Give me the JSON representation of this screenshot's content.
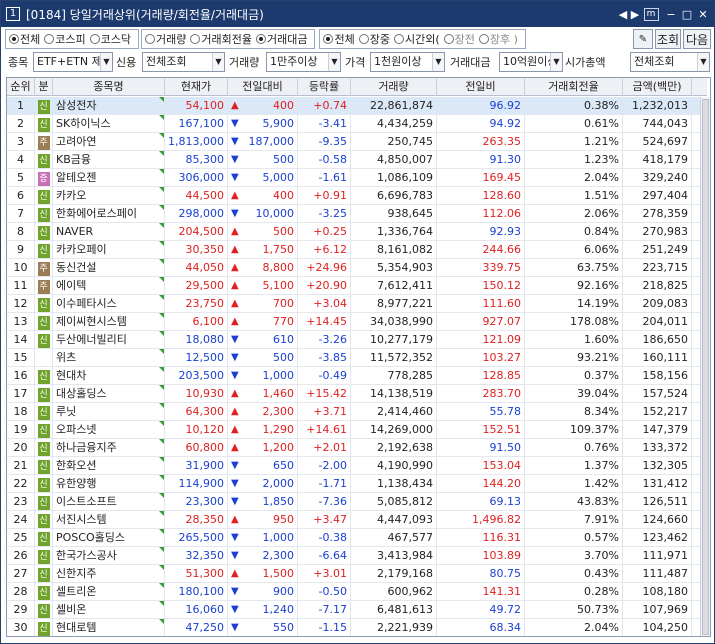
{
  "window": {
    "number": "1",
    "title": "[0184] 당일거래상위(거래량/회전율/거래대금)",
    "ctrl_arrows": "◀ ▶",
    "ctrl_box": "m",
    "ctrl_close": "✕"
  },
  "filters": {
    "market": [
      "전체",
      "코스피",
      "코스닥"
    ],
    "market_selected": 0,
    "sort": [
      "거래량",
      "거래회전율",
      "거래대금"
    ],
    "sort_selected": 2,
    "session": [
      "전체",
      "장중",
      "시간외(",
      "장전",
      "장후 )"
    ],
    "session_selected": 0,
    "query_button": "조회",
    "next_button": "다음"
  },
  "conditions": {
    "stock_label": "종목",
    "stock_value": "ETF+ETN 제",
    "credit_label": "신용",
    "credit_value": "전체조회",
    "volume_label": "거래량",
    "volume_value": "1만주이상",
    "price_label": "가격",
    "price_value": "1천원이상",
    "amount_label": "거래대금",
    "amount_value": "10억원이상",
    "mcap_label": "시가총액",
    "mcap_value": "전체조회"
  },
  "columns": [
    "순위",
    "분",
    "종목명",
    "현재가",
    "전일대비",
    "등락률",
    "거래량",
    "전일비",
    "거래회전율",
    "금액(백만)"
  ],
  "rows": [
    {
      "rank": "1",
      "badge": "신",
      "name": "삼성전자",
      "price": "54,100",
      "dir": "up",
      "change": "400",
      "rate": "+0.74",
      "volume": "22,861,874",
      "prev": "96.92",
      "prev_dir": "dn",
      "turnover": "0.38%",
      "amount": "1,232,013"
    },
    {
      "rank": "2",
      "badge": "신",
      "name": "SK하이닉스",
      "price": "167,100",
      "dir": "dn",
      "change": "5,900",
      "rate": "-3.41",
      "volume": "4,434,259",
      "prev": "94.92",
      "prev_dir": "dn",
      "turnover": "0.61%",
      "amount": "744,043"
    },
    {
      "rank": "3",
      "badge": "주",
      "name": "고려아연",
      "price": "1,813,000",
      "dir": "dn",
      "change": "187,000",
      "rate": "-9.35",
      "volume": "250,745",
      "prev": "263.35",
      "prev_dir": "up",
      "turnover": "1.21%",
      "amount": "524,697"
    },
    {
      "rank": "4",
      "badge": "신",
      "name": "KB금융",
      "price": "85,300",
      "dir": "dn",
      "change": "500",
      "rate": "-0.58",
      "volume": "4,850,007",
      "prev": "91.30",
      "prev_dir": "dn",
      "turnover": "1.23%",
      "amount": "418,179"
    },
    {
      "rank": "5",
      "badge": "증",
      "name": "알테오젠",
      "price": "306,000",
      "dir": "dn",
      "change": "5,000",
      "rate": "-1.61",
      "volume": "1,086,109",
      "prev": "169.45",
      "prev_dir": "up",
      "turnover": "2.04%",
      "amount": "329,240"
    },
    {
      "rank": "6",
      "badge": "신",
      "name": "카카오",
      "price": "44,500",
      "dir": "up",
      "change": "400",
      "rate": "+0.91",
      "volume": "6,696,783",
      "prev": "128.60",
      "prev_dir": "up",
      "turnover": "1.51%",
      "amount": "297,404"
    },
    {
      "rank": "7",
      "badge": "신",
      "name": "한화에어로스페이",
      "price": "298,000",
      "dir": "dn",
      "change": "10,000",
      "rate": "-3.25",
      "volume": "938,645",
      "prev": "112.06",
      "prev_dir": "up",
      "turnover": "2.06%",
      "amount": "278,359"
    },
    {
      "rank": "8",
      "badge": "신",
      "name": "NAVER",
      "price": "204,500",
      "dir": "up",
      "change": "500",
      "rate": "+0.25",
      "volume": "1,336,764",
      "prev": "92.93",
      "prev_dir": "dn",
      "turnover": "0.84%",
      "amount": "270,983"
    },
    {
      "rank": "9",
      "badge": "신",
      "name": "카카오페이",
      "price": "30,350",
      "dir": "up",
      "change": "1,750",
      "rate": "+6.12",
      "volume": "8,161,082",
      "prev": "244.66",
      "prev_dir": "up",
      "turnover": "6.06%",
      "amount": "251,249"
    },
    {
      "rank": "10",
      "badge": "주",
      "name": "동신건설",
      "price": "44,050",
      "dir": "up",
      "change": "8,800",
      "rate": "+24.96",
      "volume": "5,354,903",
      "prev": "339.75",
      "prev_dir": "up",
      "turnover": "63.75%",
      "amount": "223,715"
    },
    {
      "rank": "11",
      "badge": "주",
      "name": "에이텍",
      "price": "29,500",
      "dir": "up",
      "change": "5,100",
      "rate": "+20.90",
      "volume": "7,612,411",
      "prev": "150.12",
      "prev_dir": "up",
      "turnover": "92.16%",
      "amount": "218,825"
    },
    {
      "rank": "12",
      "badge": "신",
      "name": "이수페타시스",
      "price": "23,750",
      "dir": "up",
      "change": "700",
      "rate": "+3.04",
      "volume": "8,977,221",
      "prev": "111.60",
      "prev_dir": "up",
      "turnover": "14.19%",
      "amount": "209,083"
    },
    {
      "rank": "13",
      "badge": "신",
      "name": "제이씨현시스템",
      "price": "6,100",
      "dir": "up",
      "change": "770",
      "rate": "+14.45",
      "volume": "34,038,990",
      "prev": "927.07",
      "prev_dir": "up",
      "turnover": "178.08%",
      "amount": "204,011"
    },
    {
      "rank": "14",
      "badge": "신",
      "name": "두산에너빌리티",
      "price": "18,080",
      "dir": "dn",
      "change": "610",
      "rate": "-3.26",
      "volume": "10,277,179",
      "prev": "121.09",
      "prev_dir": "up",
      "turnover": "1.60%",
      "amount": "186,650"
    },
    {
      "rank": "15",
      "badge": "",
      "name": "위츠",
      "price": "12,500",
      "dir": "dn",
      "change": "500",
      "rate": "-3.85",
      "volume": "11,572,352",
      "prev": "103.27",
      "prev_dir": "up",
      "turnover": "93.21%",
      "amount": "160,111"
    },
    {
      "rank": "16",
      "badge": "신",
      "name": "현대차",
      "price": "203,500",
      "dir": "dn",
      "change": "1,000",
      "rate": "-0.49",
      "volume": "778,285",
      "prev": "128.85",
      "prev_dir": "up",
      "turnover": "0.37%",
      "amount": "158,156"
    },
    {
      "rank": "17",
      "badge": "신",
      "name": "대상홀딩스",
      "price": "10,930",
      "dir": "up",
      "change": "1,460",
      "rate": "+15.42",
      "volume": "14,138,519",
      "prev": "283.70",
      "prev_dir": "up",
      "turnover": "39.04%",
      "amount": "157,524"
    },
    {
      "rank": "18",
      "badge": "신",
      "name": "루닛",
      "price": "64,300",
      "dir": "up",
      "change": "2,300",
      "rate": "+3.71",
      "volume": "2,414,460",
      "prev": "55.78",
      "prev_dir": "dn",
      "turnover": "8.34%",
      "amount": "152,217"
    },
    {
      "rank": "19",
      "badge": "신",
      "name": "오파스넷",
      "price": "10,120",
      "dir": "up",
      "change": "1,290",
      "rate": "+14.61",
      "volume": "14,269,000",
      "prev": "152.51",
      "prev_dir": "up",
      "turnover": "109.37%",
      "amount": "147,379"
    },
    {
      "rank": "20",
      "badge": "신",
      "name": "하나금융지주",
      "price": "60,800",
      "dir": "up",
      "change": "1,200",
      "rate": "+2.01",
      "volume": "2,192,638",
      "prev": "91.50",
      "prev_dir": "dn",
      "turnover": "0.76%",
      "amount": "133,372"
    },
    {
      "rank": "21",
      "badge": "신",
      "name": "한화오션",
      "price": "31,900",
      "dir": "dn",
      "change": "650",
      "rate": "-2.00",
      "volume": "4,190,990",
      "prev": "153.04",
      "prev_dir": "up",
      "turnover": "1.37%",
      "amount": "132,305"
    },
    {
      "rank": "22",
      "badge": "신",
      "name": "유한양행",
      "price": "114,900",
      "dir": "dn",
      "change": "2,000",
      "rate": "-1.71",
      "volume": "1,138,434",
      "prev": "144.20",
      "prev_dir": "up",
      "turnover": "1.42%",
      "amount": "131,412"
    },
    {
      "rank": "23",
      "badge": "신",
      "name": "이스트소프트",
      "price": "23,300",
      "dir": "dn",
      "change": "1,850",
      "rate": "-7.36",
      "volume": "5,085,812",
      "prev": "69.13",
      "prev_dir": "dn",
      "turnover": "43.83%",
      "amount": "126,511"
    },
    {
      "rank": "24",
      "badge": "신",
      "name": "서진시스템",
      "price": "28,350",
      "dir": "up",
      "change": "950",
      "rate": "+3.47",
      "volume": "4,447,093",
      "prev": "1,496.82",
      "prev_dir": "up",
      "turnover": "7.91%",
      "amount": "124,660"
    },
    {
      "rank": "25",
      "badge": "신",
      "name": "POSCO홀딩스",
      "price": "265,500",
      "dir": "dn",
      "change": "1,000",
      "rate": "-0.38",
      "volume": "467,577",
      "prev": "116.31",
      "prev_dir": "up",
      "turnover": "0.57%",
      "amount": "123,462"
    },
    {
      "rank": "26",
      "badge": "신",
      "name": "한국가스공사",
      "price": "32,350",
      "dir": "dn",
      "change": "2,300",
      "rate": "-6.64",
      "volume": "3,413,984",
      "prev": "103.89",
      "prev_dir": "up",
      "turnover": "3.70%",
      "amount": "111,971"
    },
    {
      "rank": "27",
      "badge": "신",
      "name": "신한지주",
      "price": "51,300",
      "dir": "up",
      "change": "1,500",
      "rate": "+3.01",
      "volume": "2,179,168",
      "prev": "80.75",
      "prev_dir": "dn",
      "turnover": "0.43%",
      "amount": "111,487"
    },
    {
      "rank": "28",
      "badge": "신",
      "name": "셀트리온",
      "price": "180,100",
      "dir": "dn",
      "change": "900",
      "rate": "-0.50",
      "volume": "600,962",
      "prev": "141.31",
      "prev_dir": "up",
      "turnover": "0.28%",
      "amount": "108,180"
    },
    {
      "rank": "29",
      "badge": "신",
      "name": "셀비온",
      "price": "16,060",
      "dir": "dn",
      "change": "1,240",
      "rate": "-7.17",
      "volume": "6,481,613",
      "prev": "49.72",
      "prev_dir": "dn",
      "turnover": "50.73%",
      "amount": "107,969"
    },
    {
      "rank": "30",
      "badge": "신",
      "name": "현대로템",
      "price": "47,250",
      "dir": "dn",
      "change": "550",
      "rate": "-1.15",
      "volume": "2,221,939",
      "prev": "68.34",
      "prev_dir": "dn",
      "turnover": "2.04%",
      "amount": "104,250"
    }
  ],
  "colors": {
    "up": "#e02020",
    "down": "#1a3fd4",
    "title_bg": "#1c3a6e",
    "selected_row": "#dae8f8"
  }
}
